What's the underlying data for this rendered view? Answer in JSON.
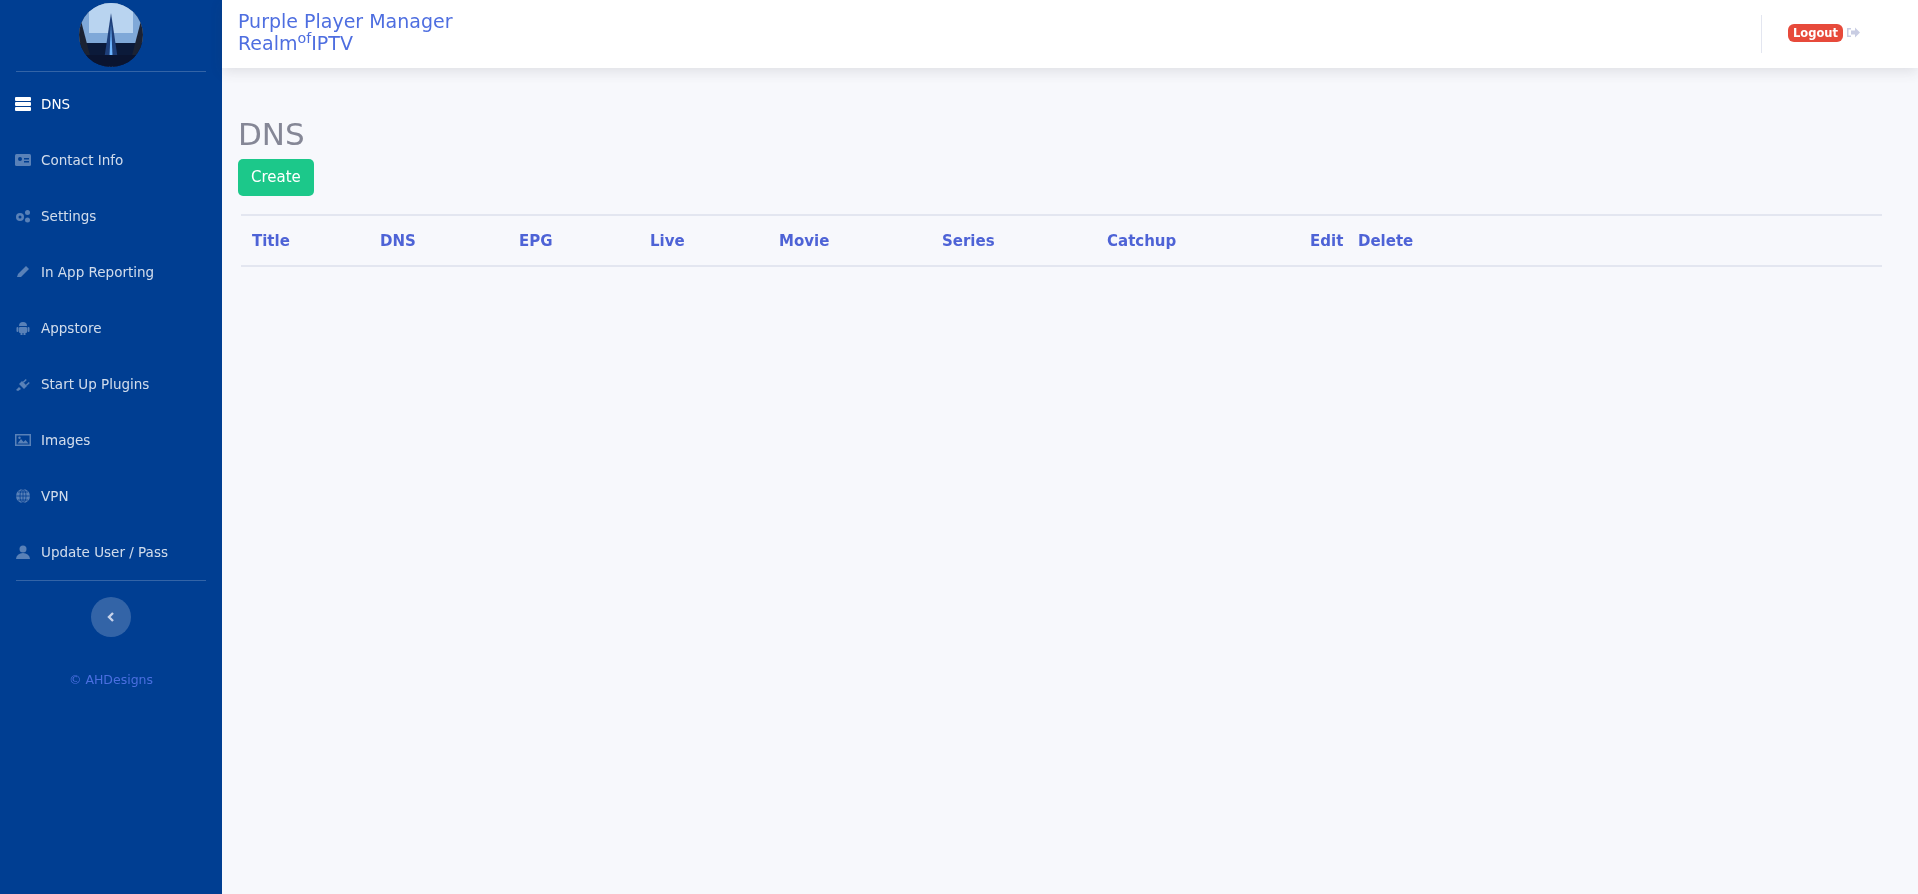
{
  "sidebar": {
    "items": [
      {
        "label": "DNS",
        "selected": true
      },
      {
        "label": "Contact Info",
        "selected": false
      },
      {
        "label": "Settings",
        "selected": false
      },
      {
        "label": "In App Reporting",
        "selected": false
      },
      {
        "label": "Appstore",
        "selected": false
      },
      {
        "label": "Start Up Plugins",
        "selected": false
      },
      {
        "label": "Images",
        "selected": false
      },
      {
        "label": "VPN",
        "selected": false
      },
      {
        "label": "Update User / Pass",
        "selected": false
      }
    ],
    "footer": "© AHDesigns"
  },
  "header": {
    "title": "Purple Player Manager",
    "subtitle": "Realm$^{of}$IPTV",
    "logout": "Logout"
  },
  "page": {
    "heading": "DNS",
    "create_button": "Create"
  },
  "table": {
    "columns": [
      "Title",
      "DNS",
      "EPG",
      "Live",
      "Movie",
      "Series",
      "Catchup",
      "Edit",
      "Delete"
    ]
  }
}
